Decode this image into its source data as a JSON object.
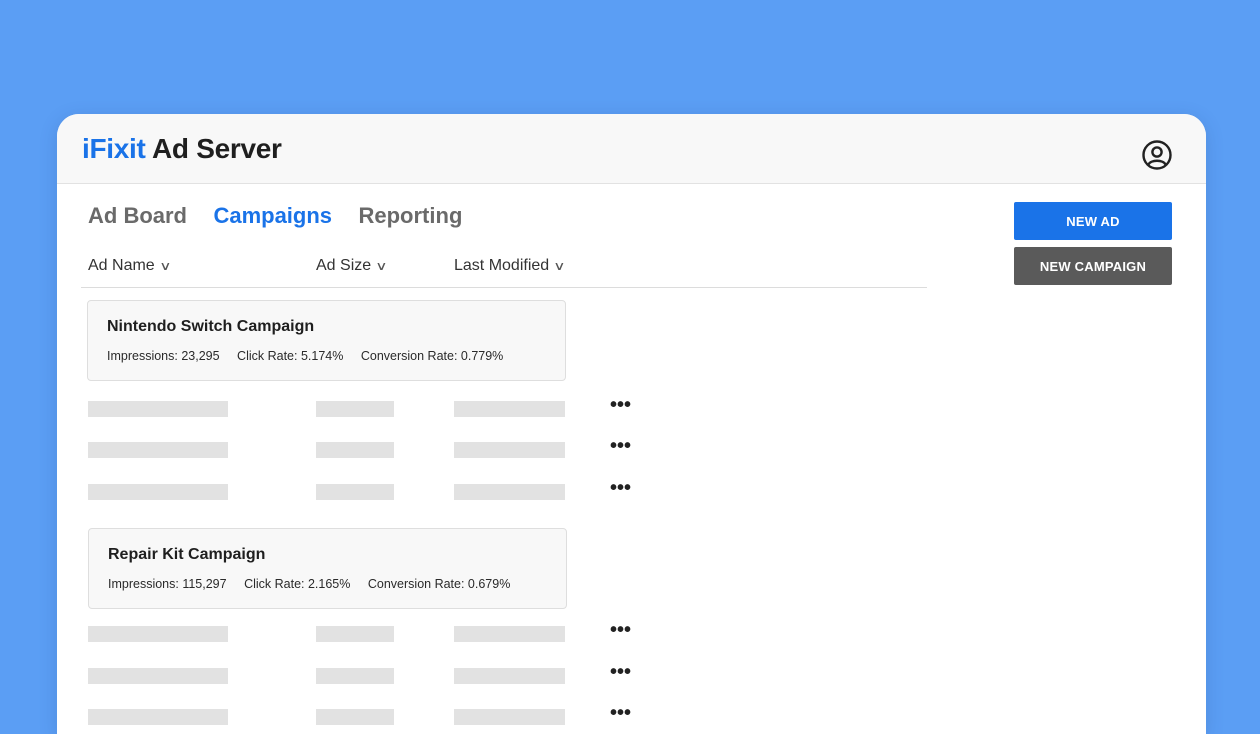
{
  "header": {
    "brand": "iFixit",
    "title": "Ad Server",
    "user_icon": "user-circle-icon"
  },
  "tabs": [
    {
      "label": "Ad Board",
      "active": false
    },
    {
      "label": "Campaigns",
      "active": true
    },
    {
      "label": "Reporting",
      "active": false
    }
  ],
  "columns": [
    {
      "label": "Ad Name"
    },
    {
      "label": "Ad Size"
    },
    {
      "label": "Last Modified"
    }
  ],
  "actions": {
    "new_ad": "NEW AD",
    "new_campaign": "NEW CAMPAIGN"
  },
  "campaigns": [
    {
      "name": "Nintendo Switch Campaign",
      "impressions": "Impressions: 23,295",
      "click_rate": "Click Rate: 5.174%",
      "conversion_rate": "Conversion Rate: 0.779%"
    },
    {
      "name": "Repair Kit Campaign",
      "impressions": "Impressions: 115,297",
      "click_rate": "Click Rate: 2.165%",
      "conversion_rate": "Conversion Rate: 0.679%"
    }
  ],
  "row_menu": "•••",
  "colors": {
    "background": "#5b9ef4",
    "accent": "#1a73e8",
    "secondary_button": "#5a5a5a",
    "placeholder_bar": "#e2e2e2"
  }
}
